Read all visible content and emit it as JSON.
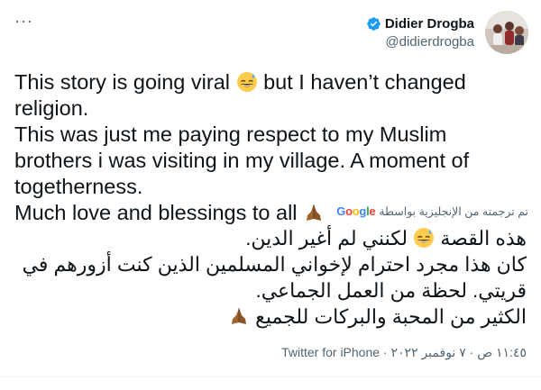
{
  "header": {
    "more_label": "···",
    "name": "Didier Drogba",
    "handle": "@didierdrogba",
    "avatar_icon": "profile-photo",
    "verified_icon": "verified-badge-icon"
  },
  "tweet": {
    "en_line1a": "This story is going viral",
    "en_line1b": "but I haven’t changed religion.",
    "en_line2": "This was just me paying respect to my Muslim brothers i was visiting in my village. A moment of togetherness.",
    "en_line3": "Much love and blessings to all",
    "translated_by": "تم ترجمته من الإنجليزية بواسطة",
    "translator": "Google",
    "ar_line1a": "هذه القصة",
    "ar_line1b": "لكنني لم أغير الدين.",
    "ar_line2": "كان هذا مجرد احترام لإخواني المسلمين الذين كنت أزورهم في قريتي. لحظة من العمل الجماعي.",
    "ar_line3": "الكثير من المحبة والبركات للجميع",
    "emoji_sweat": "grinning-sweat-emoji",
    "emoji_pray": "folded-hands-emoji"
  },
  "footer": {
    "time": "١١:٤٥ ص",
    "sep1": " · ",
    "date": "٧ نوفمبر ٢٠٢٢",
    "sep2": " · ",
    "source": "Twitter for iPhone"
  },
  "colors": {
    "text": "#0f1419",
    "secondary": "#536471",
    "verified": "#1d9bf0"
  }
}
